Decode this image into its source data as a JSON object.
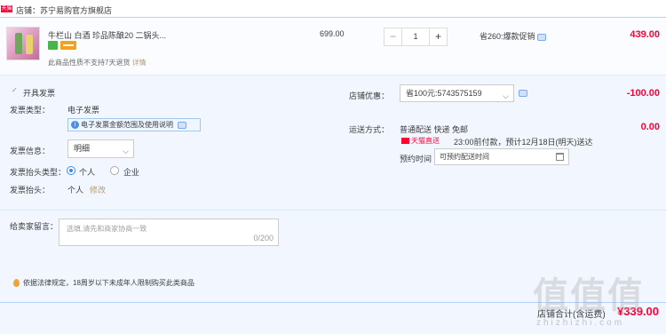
{
  "shop": {
    "badge": "天猫",
    "label": "店铺：苏宁易购官方旗舰店"
  },
  "item": {
    "name": "牛栏山 白酒 珍品陈酿20 二锅头...",
    "notice": "此商品性质不支持7天退货",
    "notice_link": "详情",
    "price": "699.00",
    "qty_minus": "−",
    "qty_value": "1",
    "qty_plus": "+",
    "promo": "省260:爆款促销",
    "subtotal": "439.00"
  },
  "invoice": {
    "open_label": "开具发票",
    "type_label": "发票类型：",
    "type_value": "电子发票",
    "tip": "电子发票金额范围及使用说明",
    "info_label": "发票信息：",
    "info_value": "明细",
    "header_type_label": "发票抬头类型：",
    "header_personal": "个人",
    "header_company": "企业",
    "header_label": "发票抬头：",
    "header_value": "个人",
    "header_edit": "修改"
  },
  "coupon": {
    "label": "店铺优惠：",
    "value": "省100元:5743575159",
    "amount": "-100.00"
  },
  "shipping": {
    "label": "运送方式：",
    "method": "普通配送 快递 免邮",
    "fee": "0.00",
    "fast_label": "天猫直送",
    "fast_detail": "23:00前付款，预计12月18日(明天)送达",
    "schedule_label": "预约时间",
    "schedule_value": "可预约配送时间"
  },
  "memo": {
    "label": "给卖家留言：",
    "placeholder": "选填,请先和商家协商一致",
    "counter": "0/200"
  },
  "law_notice": "依据法律规定，18周岁以下未成年人限制购买此类商品",
  "total": {
    "label": "店铺合计(含运费)",
    "value": "¥339.00"
  },
  "watermark": {
    "big": "值值值",
    "small": "zhizhizhi.com"
  },
  "colors": {
    "accent_red": "#ff0036",
    "link_brown": "#b89873",
    "blue_border": "#b2d1ff"
  }
}
